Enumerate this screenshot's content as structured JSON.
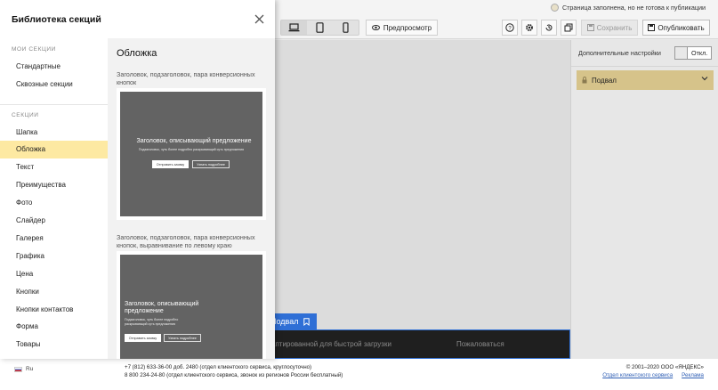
{
  "topbar": {
    "status_text": "Страница заполнена, но не готова к публикации",
    "preview_label": "Предпросмотр",
    "save_label": "Сохранить",
    "publish_label": "Опубликовать"
  },
  "right_panel": {
    "header": "Дополнительные настройки",
    "toggle_label": "Откл.",
    "section_label": "Подвал"
  },
  "canvas": {
    "footer_label": "Подвал",
    "footer_text_1": "аптированной для быстрой загрузки",
    "footer_text_2": "Пожаловаться"
  },
  "bottom": {
    "lang": "Ru",
    "contacts_line1": "+7 (812) 633-36-00 доб. 2480 (отдел клиентского сервиса, круглосуточно)",
    "contacts_line2": "8 800 234-24-80 (отдел клиентского сервиса, звонок из регионов России бесплатный)",
    "copyright": "© 2001–2020 ООО «ЯНДЕКС»",
    "link_support": "Отдел клиентского сервиса",
    "link_ads": "Реклама"
  },
  "modal": {
    "title": "Библиотека секций",
    "my_sections_title": "МОИ СЕКЦИИ",
    "my_sections": [
      "Стандартные",
      "Сквозные секции"
    ],
    "sections_title": "СЕКЦИИ",
    "sections": [
      "Шапка",
      "Обложка",
      "Текст",
      "Преимущества",
      "Фото",
      "Слайдер",
      "Галерея",
      "Графика",
      "Цена",
      "Кнопки",
      "Кнопки контактов",
      "Форма",
      "Товары"
    ],
    "active_section": "Обложка",
    "content_title": "Обложка",
    "cards": [
      {
        "description": "Заголовок, подзаголовок, пара конверсионных кнопок",
        "thumb_heading": "Заголовок, описывающий предложение",
        "thumb_sub": "Подзаголовок, чуть более подробно раскрывающий суть предложения",
        "btn1": "Отправить заявку",
        "btn2": "Узнать подробнее"
      },
      {
        "description": "Заголовок, подзаголовок, пара конверсионных кнопок, выравнивание по левому краю",
        "thumb_heading": "Заголовок, описывающий предложение",
        "thumb_sub": "Подзаголовок, чуть более подробно раскрывающий суть предложения",
        "btn1": "Отправить заявку",
        "btn2": "Узнать подробнее"
      }
    ]
  }
}
